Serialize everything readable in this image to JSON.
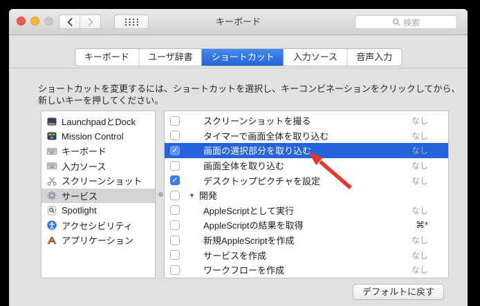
{
  "titlebar": {
    "title": "キーボード",
    "search_placeholder": "検索"
  },
  "tabs": [
    {
      "label": "キーボード",
      "selected": false
    },
    {
      "label": "ユーザ辞書",
      "selected": false
    },
    {
      "label": "ショートカット",
      "selected": true
    },
    {
      "label": "入力ソース",
      "selected": false
    },
    {
      "label": "音声入力",
      "selected": false
    }
  ],
  "description": "ショートカットを変更するには、ショートカットを選択し、キーコンビネーションをクリックしてから、新しいキーを押してください。",
  "sidebar": {
    "items": [
      {
        "label": "LaunchpadとDock",
        "icon": "dock-icon",
        "selected": false
      },
      {
        "label": "Mission Control",
        "icon": "mission-control-icon",
        "selected": false
      },
      {
        "label": "キーボード",
        "icon": "keyboard-icon",
        "selected": false
      },
      {
        "label": "入力ソース",
        "icon": "input-source-icon",
        "selected": false
      },
      {
        "label": "スクリーンショット",
        "icon": "screenshot-icon",
        "selected": false
      },
      {
        "label": "サービス",
        "icon": "services-gear-icon",
        "selected": true
      },
      {
        "label": "Spotlight",
        "icon": "spotlight-icon",
        "selected": false
      },
      {
        "label": "アクセシビリティ",
        "icon": "accessibility-icon",
        "selected": false
      },
      {
        "label": "アプリケーション",
        "icon": "applications-icon",
        "selected": false
      }
    ]
  },
  "shortcuts": {
    "rows": [
      {
        "checked": false,
        "label": "スクリーンショットを撮る",
        "shortcut": "なし",
        "selected": false,
        "group": false
      },
      {
        "checked": false,
        "label": "タイマーで画面全体を取り込む",
        "shortcut": "なし",
        "selected": false,
        "group": false
      },
      {
        "checked": true,
        "label": "画面の選択部分を取り込む",
        "shortcut": "なし",
        "selected": true,
        "group": false
      },
      {
        "checked": false,
        "label": "画面全体を取り込む",
        "shortcut": "なし",
        "selected": false,
        "group": false
      },
      {
        "checked": true,
        "label": "デスクトップピクチャを設定",
        "shortcut": "なし",
        "selected": false,
        "group": false
      },
      {
        "checked": false,
        "label": "開発",
        "shortcut": "",
        "selected": false,
        "group": true
      },
      {
        "checked": false,
        "label": "AppleScriptとして実行",
        "shortcut": "なし",
        "selected": false,
        "group": false
      },
      {
        "checked": false,
        "label": "AppleScriptの結果を取得",
        "shortcut": "⌘*",
        "selected": false,
        "group": false,
        "shortcut_assigned": true
      },
      {
        "checked": false,
        "label": "新規AppleScriptを作成",
        "shortcut": "なし",
        "selected": false,
        "group": false
      },
      {
        "checked": false,
        "label": "サービスを作成",
        "shortcut": "なし",
        "selected": false,
        "group": false
      },
      {
        "checked": false,
        "label": "ワークフローを作成",
        "shortcut": "なし",
        "selected": false,
        "group": false
      }
    ]
  },
  "footer": {
    "restore_defaults": "デフォルトに戻す"
  },
  "colors": {
    "selection_blue": "#2463da",
    "tab_blue": "#2365da",
    "checkbox_blue": "#3b7ff5",
    "arrow_red": "#e73527",
    "shortcut_muted": "#9e9e9e",
    "sidebar_selected_gray": "#d4d4d4"
  }
}
